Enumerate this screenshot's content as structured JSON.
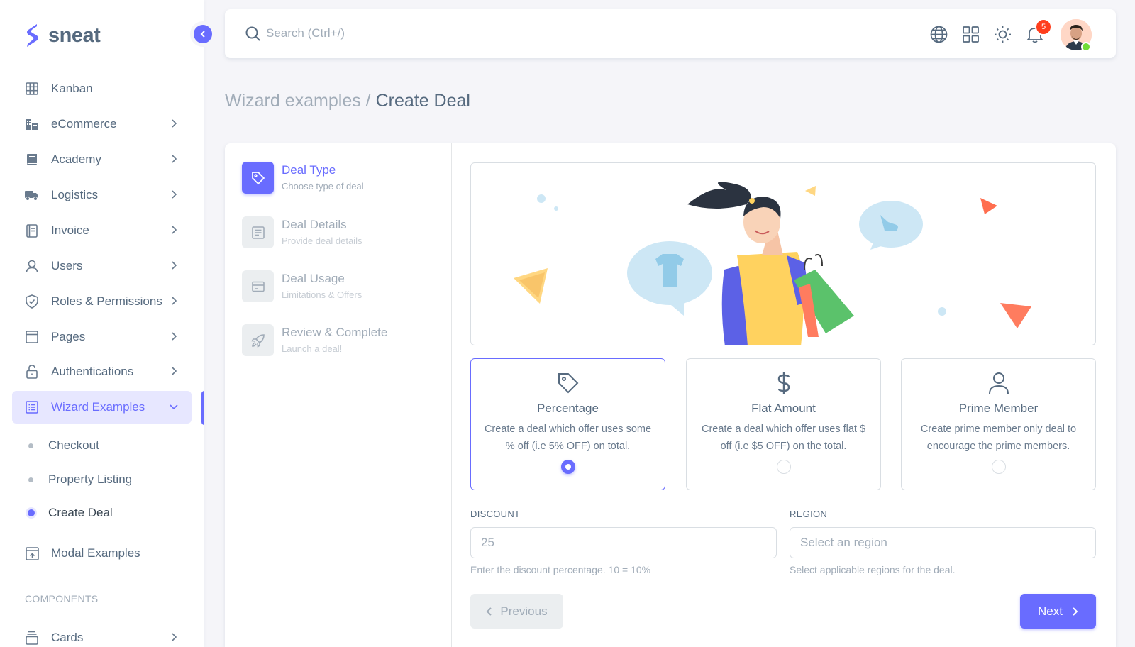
{
  "brand": {
    "name": "sneat"
  },
  "colors": {
    "primary": "#696cff",
    "text": "#566a7f",
    "muted": "#a1acb8",
    "danger": "#ff3e1d",
    "success": "#71dd37"
  },
  "sidebar": {
    "items": [
      {
        "label": "Kanban",
        "icon": "kanban-icon"
      },
      {
        "label": "eCommerce",
        "icon": "ecommerce-icon"
      },
      {
        "label": "Academy",
        "icon": "academy-icon"
      },
      {
        "label": "Logistics",
        "icon": "truck-icon"
      },
      {
        "label": "Invoice",
        "icon": "invoice-icon"
      },
      {
        "label": "Users",
        "icon": "user-icon"
      },
      {
        "label": "Roles & Permissions",
        "icon": "shield-icon"
      },
      {
        "label": "Pages",
        "icon": "pages-icon"
      },
      {
        "label": "Authentications",
        "icon": "lock-icon"
      },
      {
        "label": "Wizard Examples",
        "icon": "wizard-icon"
      }
    ],
    "wizard_sub": [
      "Checkout",
      "Property Listing",
      "Create Deal"
    ],
    "modal_examples": "Modal Examples",
    "section_components": "COMPONENTS",
    "cards": "Cards"
  },
  "navbar": {
    "search_placeholder": "Search (Ctrl+/)",
    "notification_count": "5"
  },
  "breadcrumb": {
    "parent": "Wizard examples /",
    "current": "Create Deal"
  },
  "steps": [
    {
      "title": "Deal Type",
      "subtitle": "Choose type of deal"
    },
    {
      "title": "Deal Details",
      "subtitle": "Provide deal details"
    },
    {
      "title": "Deal Usage",
      "subtitle": "Limitations & Offers"
    },
    {
      "title": "Review & Complete",
      "subtitle": "Launch a deal!"
    }
  ],
  "options": [
    {
      "title": "Percentage",
      "desc": "Create a deal which offer uses some % off (i.e 5% OFF) on total.",
      "selected": true
    },
    {
      "title": "Flat Amount",
      "desc": "Create a deal which offer uses flat $ off (i.e $5 OFF) on the total.",
      "selected": false
    },
    {
      "title": "Prime Member",
      "desc": "Create prime member only deal to encourage the prime members.",
      "selected": false
    }
  ],
  "form": {
    "discount_label": "DISCOUNT",
    "discount_placeholder": "25",
    "discount_help": "Enter the discount percentage. 10 = 10%",
    "region_label": "REGION",
    "region_placeholder": "Select an region",
    "region_help": "Select applicable regions for the deal."
  },
  "buttons": {
    "previous": "Previous",
    "next": "Next"
  }
}
